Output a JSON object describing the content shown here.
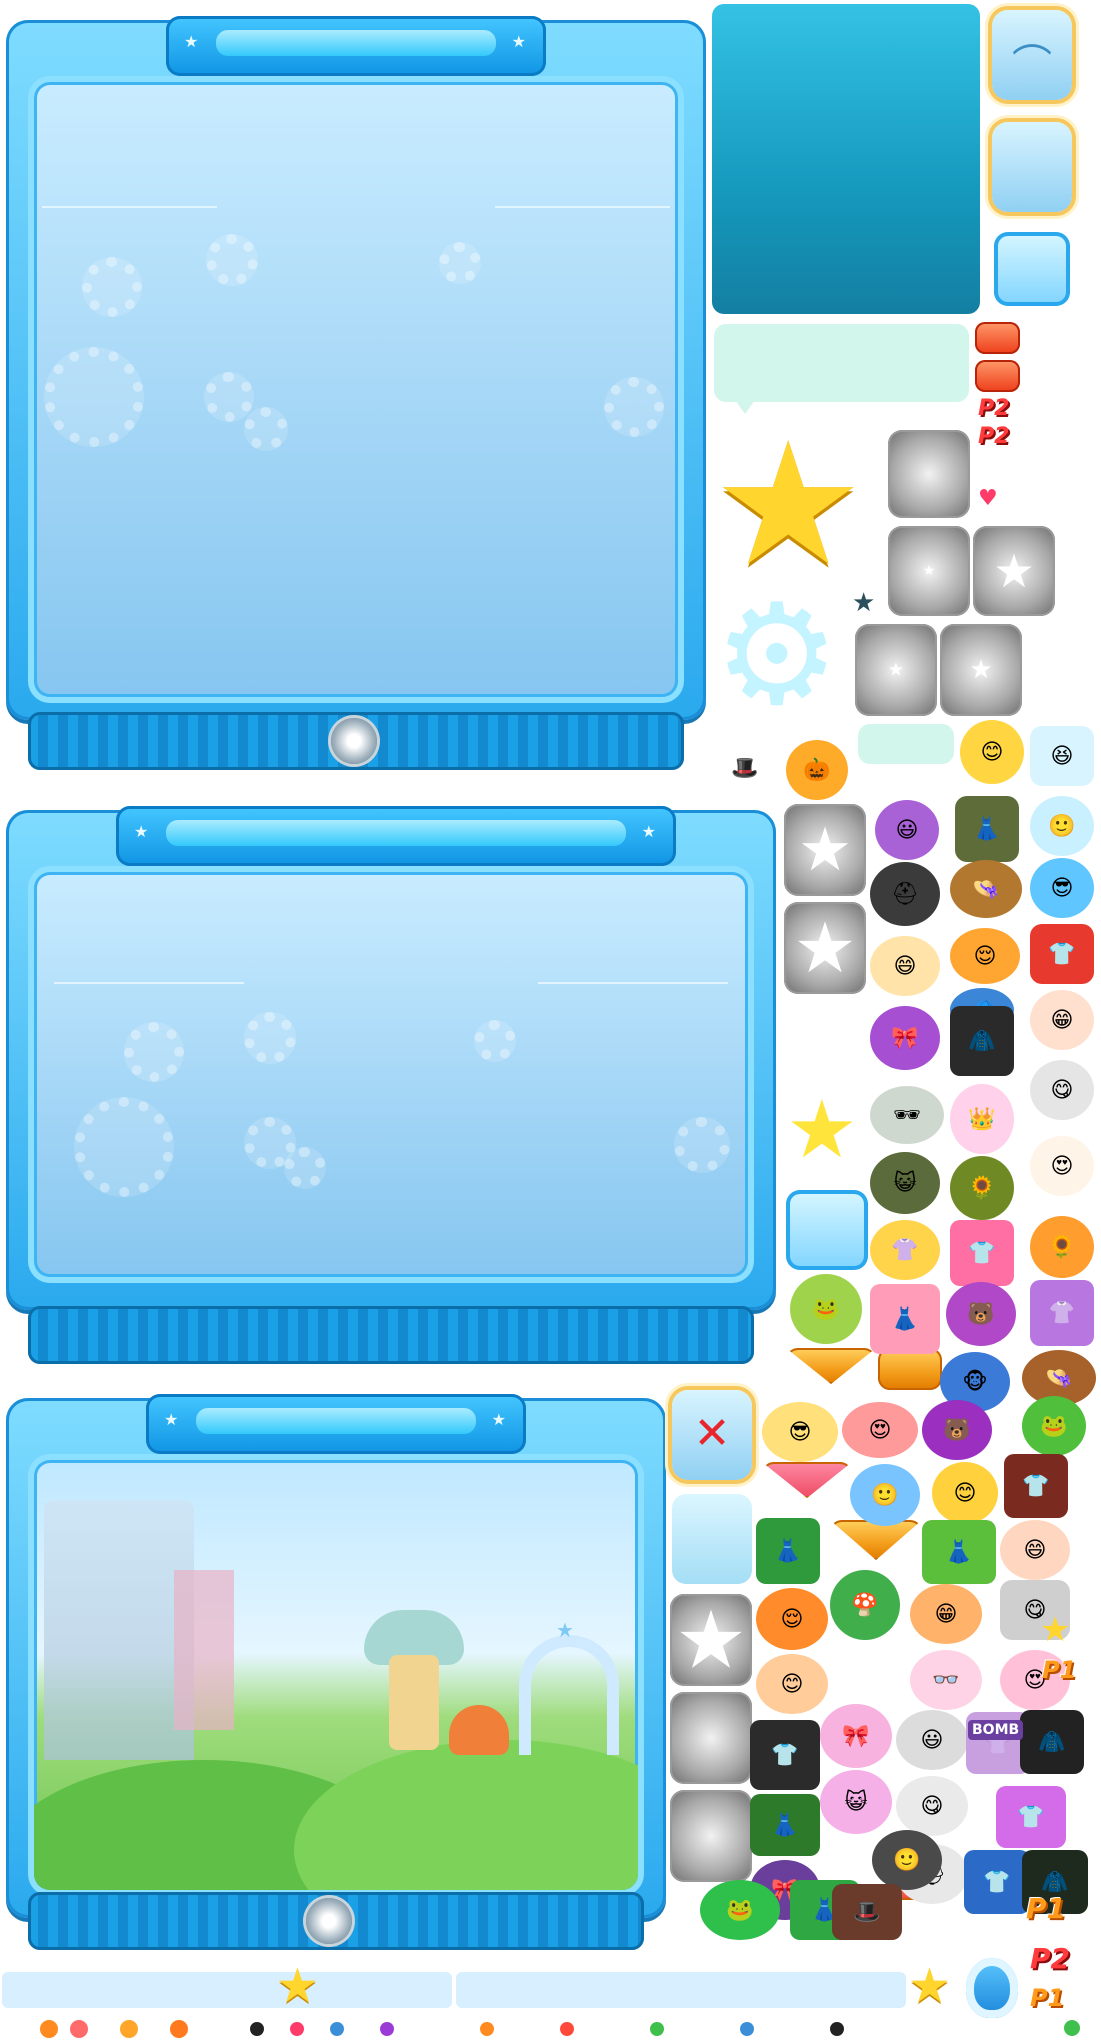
{
  "sprite_sheet": {
    "colors": {
      "panel_blue": "#2aa9ee",
      "panel_light": "#a4d6f6",
      "accent_orange": "#f39c1a",
      "accent_red": "#ee3d1a",
      "star_yellow": "#ffd52e",
      "bubble_mint": "#d3f6ec",
      "teal_box": "#1aa6c6"
    },
    "icons": {
      "hanger": "hanger-icon",
      "close": "close-icon",
      "star": "star-icon",
      "gear": "gear-icon"
    },
    "labels": {
      "p1_a": "P1",
      "p2_a": "P2",
      "p2_b": "P2",
      "p1_b": "P1",
      "p1_c": "P1",
      "p2_c": "P2",
      "p1_d": "P1",
      "bomb": "BOMB"
    },
    "glyphs": {
      "close_x": "✕",
      "star": "★",
      "star_small": "★",
      "hanger": "⌒",
      "gear": "⚙"
    },
    "avatar_parts": [
      "😊",
      "😃",
      "🙂",
      "😎",
      "😄",
      "😆",
      "😌",
      "😁",
      "😋",
      "😍",
      "😺",
      "🐸",
      "🎩",
      "👒",
      "⛑",
      "🎀",
      "👓",
      "🕶",
      "👗",
      "👕",
      "🧥",
      "👚",
      "🎃",
      "🐻",
      "🦊",
      "🐷",
      "🐵",
      "🐼",
      "👑",
      "🌻",
      "🍄",
      "🧢"
    ]
  }
}
